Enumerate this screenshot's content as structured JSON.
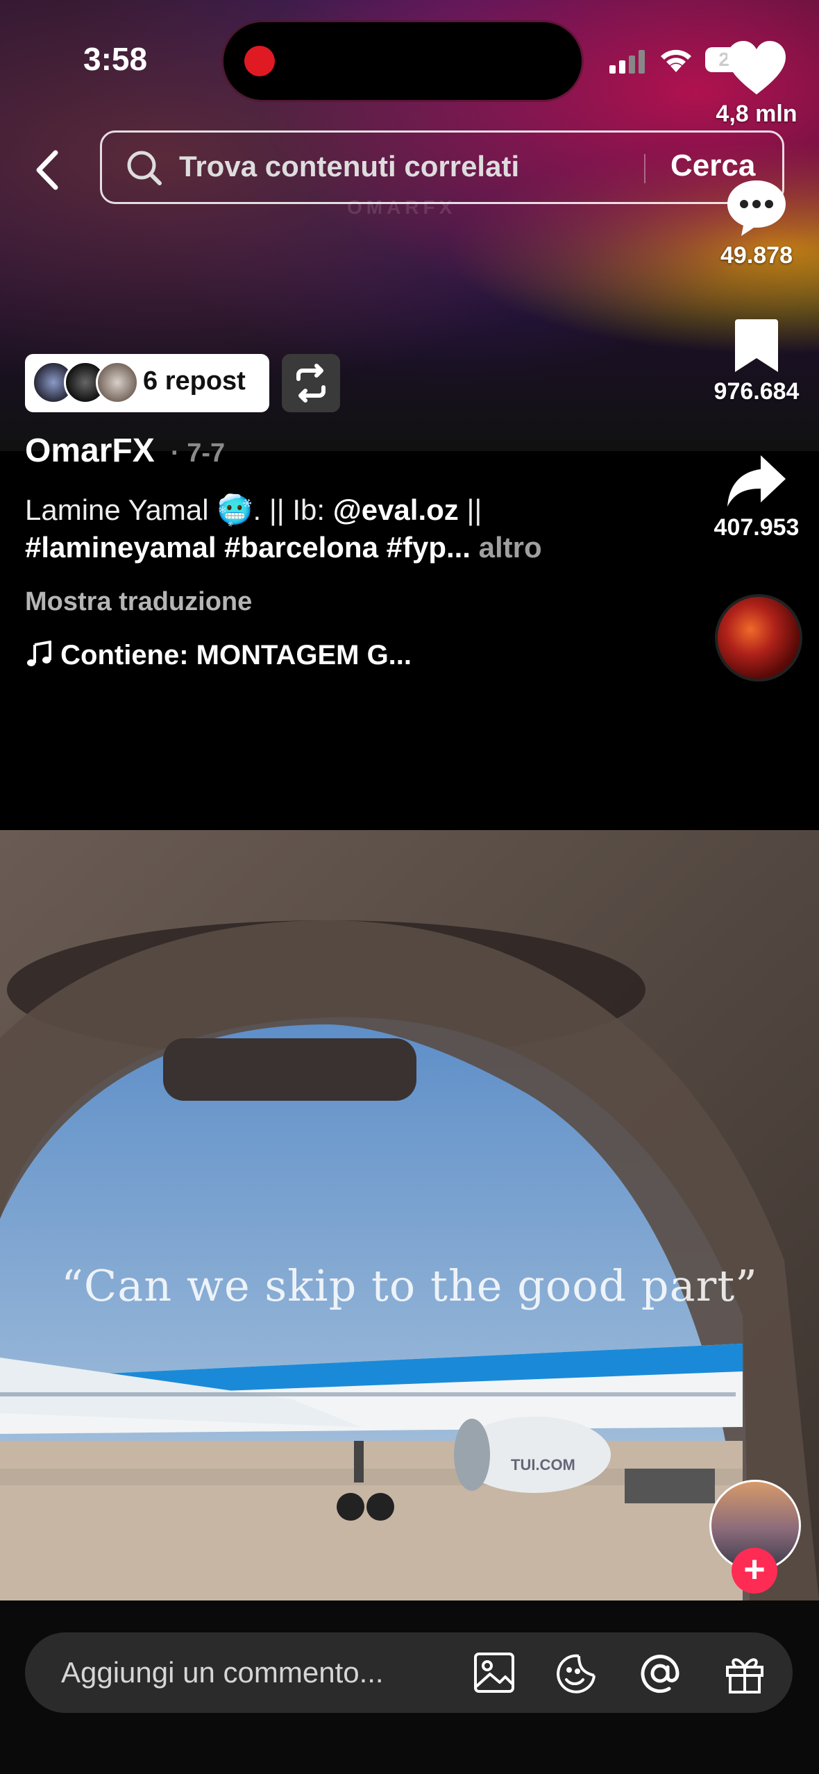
{
  "status_bar": {
    "time": "3:58",
    "battery": "23"
  },
  "search": {
    "placeholder": "Trova contenuti correlati",
    "button": "Cerca"
  },
  "video_overlay": {
    "watermark": "OMARFX"
  },
  "actions": {
    "likes": "4,8 mln",
    "comments": "49.878",
    "saves": "976.684",
    "shares": "407.953"
  },
  "repost": {
    "label": "6 repost"
  },
  "post": {
    "author": "OmarFX",
    "date": "· 7-7",
    "caption_part1": "Lamine Yamal 🥶. || Ib: ",
    "mention": "@eval.oz",
    "caption_part2": " ||",
    "hashtags": "#lamineyamal #barcelona #fyp...",
    "more": "altro",
    "translate": "Mostra traduzione",
    "music": "Contiene: MONTAGEM G..."
  },
  "next_video": {
    "caption": "“Can we skip to the good part”",
    "plane_text": "TUI.COM"
  },
  "comment_bar": {
    "placeholder": "Aggiungi un commento..."
  },
  "colors": {
    "accent_pink": "#fe2c55",
    "record_red": "#e01a22"
  },
  "icons": [
    "back-icon",
    "search-icon",
    "heart-icon",
    "comment-icon",
    "bookmark-icon",
    "share-icon",
    "repost-icon",
    "music-note-icon",
    "image-icon",
    "emoji-icon",
    "mention-icon",
    "gift-icon",
    "plus-icon"
  ]
}
